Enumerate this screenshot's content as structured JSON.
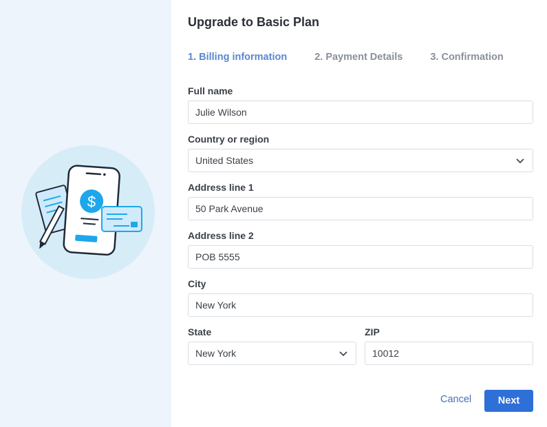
{
  "dialog": {
    "title": "Upgrade to Basic Plan"
  },
  "steps": [
    {
      "label": "1. Billing information",
      "active": true
    },
    {
      "label": "2. Payment Details",
      "active": false
    },
    {
      "label": "3. Confirmation",
      "active": false
    }
  ],
  "form": {
    "full_name": {
      "label": "Full name",
      "value": "Julie Wilson"
    },
    "country": {
      "label": "Country or region",
      "value": "United States"
    },
    "address1": {
      "label": "Address line 1",
      "value": "50 Park Avenue"
    },
    "address2": {
      "label": "Address line 2",
      "value": "POB 5555"
    },
    "city": {
      "label": "City",
      "value": "New York"
    },
    "state": {
      "label": "State",
      "value": "New York"
    },
    "zip": {
      "label": "ZIP",
      "value": "10012"
    }
  },
  "actions": {
    "cancel": "Cancel",
    "next": "Next"
  },
  "icons": {
    "illustration": "phone-payment-illustration-icon",
    "dollar": "dollar-icon",
    "card": "credit-card-icon",
    "pencil": "pencil-icon",
    "chevron": "chevron-down-icon"
  },
  "colors": {
    "accent": "#2e6fd8",
    "active_step": "#5b86cf",
    "panel_bg": "#eef4fc",
    "illustration_circle": "#d6edf8",
    "illustration_blue": "#1ea7ea"
  }
}
